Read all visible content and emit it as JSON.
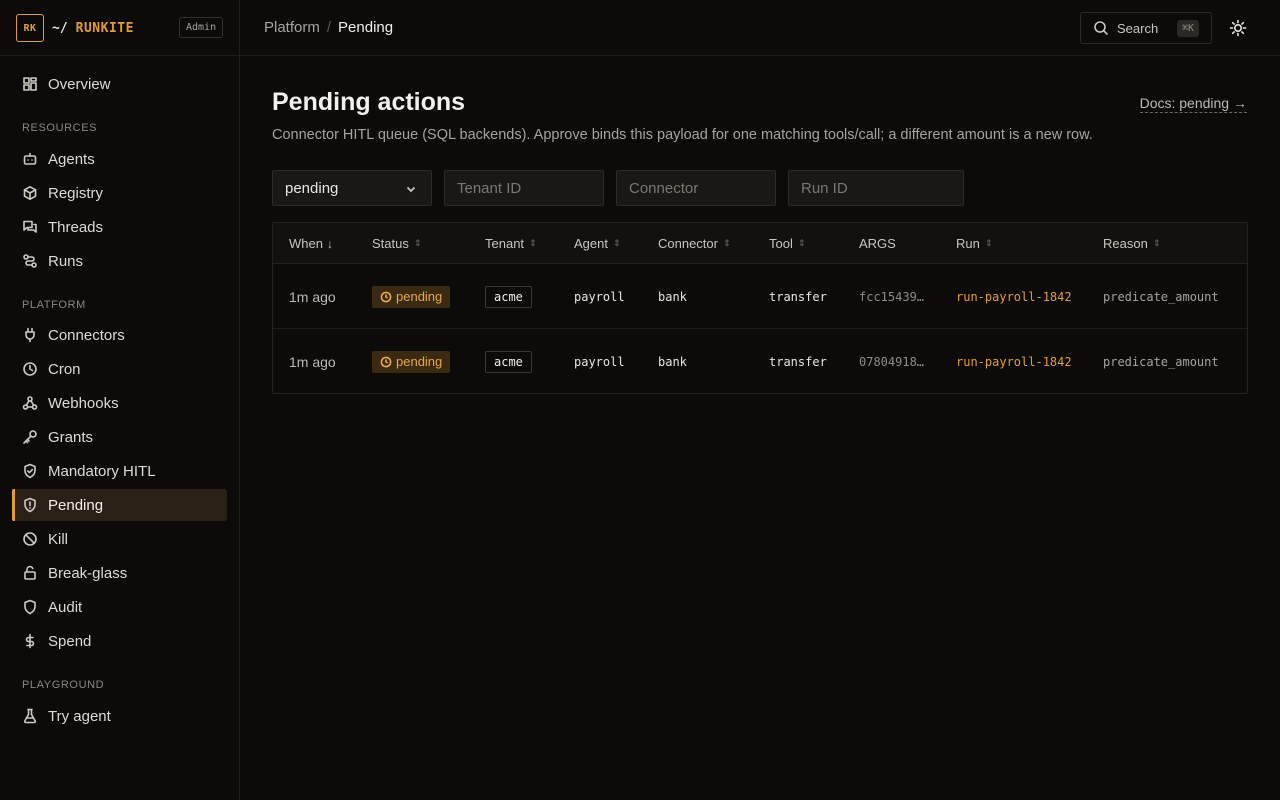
{
  "brand": {
    "logo_text": "RK",
    "path": "~/",
    "name": "RUNKITE",
    "badge": "Admin"
  },
  "sidebar": {
    "top_items": [
      {
        "label": "Overview",
        "icon": "grid-icon"
      }
    ],
    "sections": [
      {
        "title": "Resources",
        "items": [
          {
            "label": "Agents",
            "icon": "bot-icon"
          },
          {
            "label": "Registry",
            "icon": "package-icon"
          },
          {
            "label": "Threads",
            "icon": "messages-icon"
          },
          {
            "label": "Runs",
            "icon": "route-icon"
          }
        ]
      },
      {
        "title": "Platform",
        "items": [
          {
            "label": "Connectors",
            "icon": "plug-icon"
          },
          {
            "label": "Cron",
            "icon": "clock-icon"
          },
          {
            "label": "Webhooks",
            "icon": "webhook-icon"
          },
          {
            "label": "Grants",
            "icon": "key-icon"
          },
          {
            "label": "Mandatory HITL",
            "icon": "shield-check-icon"
          },
          {
            "label": "Pending",
            "icon": "shield-alert-icon",
            "active": true
          },
          {
            "label": "Kill",
            "icon": "ban-icon"
          },
          {
            "label": "Break-glass",
            "icon": "lock-open-icon"
          },
          {
            "label": "Audit",
            "icon": "shield-icon"
          },
          {
            "label": "Spend",
            "icon": "dollar-icon"
          }
        ]
      },
      {
        "title": "Playground",
        "items": [
          {
            "label": "Try agent",
            "icon": "flask-icon"
          }
        ]
      }
    ]
  },
  "header": {
    "breadcrumb_parent": "Platform",
    "breadcrumb_sep": "/",
    "breadcrumb_current": "Pending",
    "search_label": "Search",
    "search_shortcut": "⌘K"
  },
  "main": {
    "title": "Pending actions",
    "docs_link": "Docs: pending →",
    "subtitle": "Connector HITL queue (SQL backends). Approve binds this payload for one matching tools/call; a different amount is a new row.",
    "filters": {
      "status_value": "pending",
      "tenant_placeholder": "Tenant ID",
      "connector_placeholder": "Connector",
      "run_placeholder": "Run ID"
    },
    "table": {
      "columns": [
        "When",
        "Status",
        "Tenant",
        "Agent",
        "Connector",
        "Tool",
        "ARGS",
        "Run",
        "Reason"
      ],
      "sort_desc_glyph": "↓",
      "sort_glyph": "⇕",
      "rows": [
        {
          "when": "1m ago",
          "status": "pending",
          "tenant": "acme",
          "agent": "payroll",
          "connector": "bank",
          "tool": "transfer",
          "args": "fcc15439…",
          "run": "run-payroll-1842",
          "reason": "predicate_amount"
        },
        {
          "when": "1m ago",
          "status": "pending",
          "tenant": "acme",
          "agent": "payroll",
          "connector": "bank",
          "tool": "transfer",
          "args": "07804918…",
          "run": "run-payroll-1842",
          "reason": "predicate_amount"
        }
      ]
    }
  },
  "colors": {
    "accent": "#e39c3a",
    "background": "#0c0b0a",
    "status_pending_bg": "#3a2a12",
    "status_pending_fg": "#e9a748"
  }
}
